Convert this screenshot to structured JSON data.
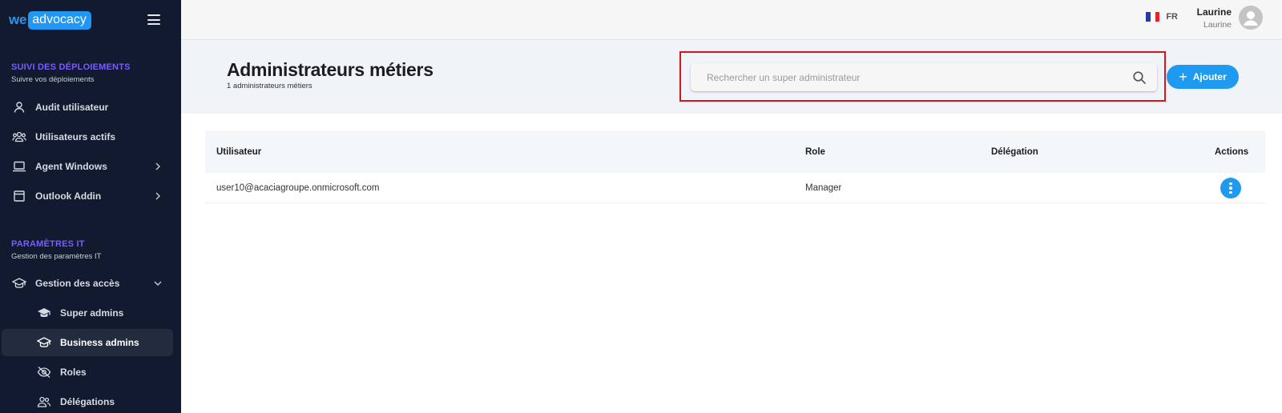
{
  "brand": {
    "we": "we",
    "advocacy": "advocacy"
  },
  "sidebar": {
    "sections": [
      {
        "title": "SUIVI DES DÉPLOIEMENTS",
        "subtitle": "Suivre vos déploiements"
      },
      {
        "title": "PARAMÈTRES IT",
        "subtitle": "Gestion des paramètres IT"
      }
    ],
    "items": [
      {
        "label": "Audit utilisateur",
        "icon": "user-icon"
      },
      {
        "label": "Utilisateurs actifs",
        "icon": "users-group-icon"
      },
      {
        "label": "Agent Windows",
        "icon": "laptop-icon"
      },
      {
        "label": "Outlook Addin",
        "icon": "window-icon"
      },
      {
        "label": "Gestion des accès",
        "icon": "graduation-cap-icon"
      },
      {
        "label": "Super admins",
        "icon": "graduation-cap-solid-icon"
      },
      {
        "label": "Business admins",
        "icon": "graduation-cap-icon"
      },
      {
        "label": "Roles",
        "icon": "eye-off-icon"
      },
      {
        "label": "Délégations",
        "icon": "people-icon"
      }
    ]
  },
  "topbar": {
    "language": "FR",
    "user_name": "Laurine",
    "user_sub": "Laurine"
  },
  "header": {
    "title": "Administrateurs métiers",
    "count_text": "1 administrateurs métiers",
    "search_placeholder": "Rechercher un super administrateur",
    "add_label": "Ajouter"
  },
  "table": {
    "columns": [
      "Utilisateur",
      "Role",
      "Délégation",
      "Actions"
    ],
    "rows": [
      {
        "user": "user10@acaciagroupe.onmicrosoft.com",
        "role": "Manager",
        "delegation": ""
      }
    ]
  },
  "colors": {
    "sidebar_bg": "#111a2e",
    "accent": "#1e9bf0",
    "section_title": "#7a5cff",
    "highlight_border": "#d9141b"
  }
}
